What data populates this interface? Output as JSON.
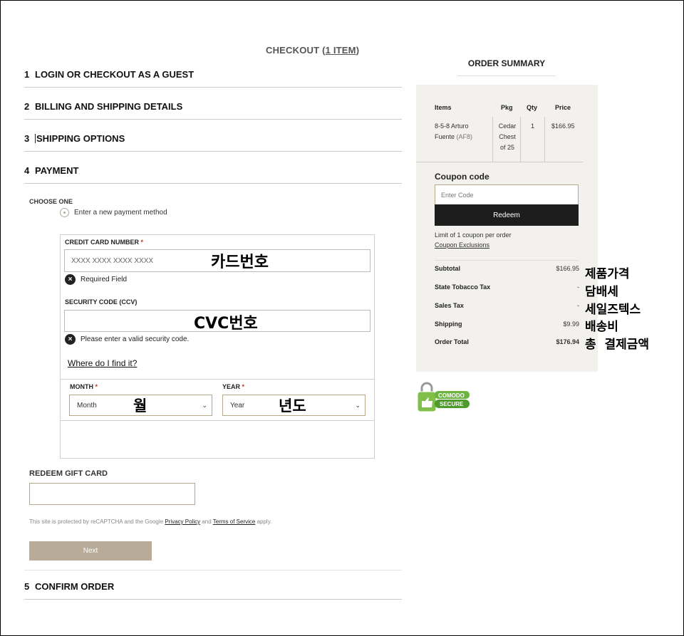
{
  "checkout": {
    "title": "CHECKOUT (",
    "item_count": "1 ITEM",
    "close": ")"
  },
  "steps": [
    {
      "num": "1",
      "label": "LOGIN OR CHECKOUT AS A GUEST"
    },
    {
      "num": "2",
      "label": "BILLING AND SHIPPING DETAILS"
    },
    {
      "num": "3",
      "label": "SHIPPING OPTIONS"
    },
    {
      "num": "4",
      "label": "PAYMENT"
    },
    {
      "num": "5",
      "label": "CONFIRM ORDER"
    }
  ],
  "payment": {
    "choose_one": "CHOOSE ONE",
    "new_method": "Enter a new payment method",
    "card_number_label": "CREDIT CARD NUMBER",
    "required_mark": "*",
    "card_number_placeholder": "XXXX XXXX XXXX XXXX",
    "card_number_annotation": "카드번호",
    "required_error": "Required Field",
    "error_icon": "×",
    "security_label": "SECURITY CODE (CCV)",
    "security_annotation": "CVC번호",
    "security_error": "Please enter a valid security code.",
    "where_find": "Where do I find it?",
    "month_label": "MONTH",
    "month_value": "Month",
    "month_annotation": "월",
    "year_label": "YEAR",
    "year_value": "Year",
    "year_annotation": "년도",
    "chevron": "⌄"
  },
  "gift_card": {
    "label": "REDEEM GIFT CARD"
  },
  "captcha": {
    "prefix": "This site is protected by reCAPTCHA and the Google ",
    "privacy": "Privacy Policy",
    "and": " and ",
    "terms": "Terms of Service",
    "suffix": " apply."
  },
  "next_button": "Next",
  "order_summary": {
    "title": "ORDER SUMMARY",
    "columns": [
      "Items",
      "Pkg",
      "Qty",
      "Price"
    ],
    "item": {
      "name": "8-5-8 Arturo",
      "name2": "Fuente",
      "code": "(AF8)",
      "pkg1": "Cedar",
      "pkg2": "Chest",
      "pkg3": "of 25",
      "qty": "1",
      "price": "$166.95"
    },
    "coupon_title": "Coupon code",
    "coupon_placeholder": "Enter Code",
    "redeem": "Redeem",
    "limit": "Limit of 1 coupon per order",
    "exclusions": "Coupon Exclusions",
    "totals": [
      {
        "label": "Subtotal",
        "value": "$166.95",
        "annotation": "제품가격"
      },
      {
        "label": "State Tobacco Tax",
        "value": "-",
        "annotation": "담배세"
      },
      {
        "label": "Sales Tax",
        "value": "-",
        "annotation": "세일즈텍스"
      },
      {
        "label": "Shipping",
        "value": "$9.99",
        "annotation": "배송비"
      },
      {
        "label": "Order Total",
        "value": "$176.94",
        "annotation": "총  결제금액"
      }
    ]
  },
  "badge": {
    "line1": "COMODO",
    "line2": "SECURE",
    "color": "#6cb33f"
  }
}
